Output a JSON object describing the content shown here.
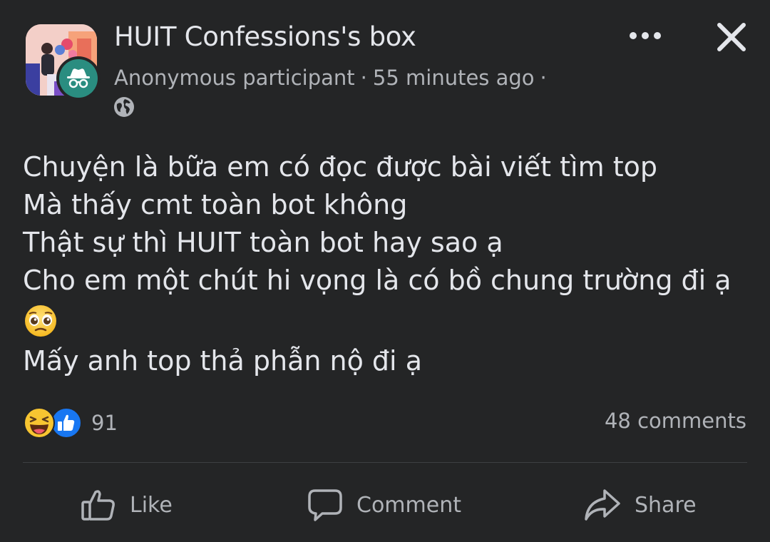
{
  "header": {
    "page_name": "HUIT Confessions's box",
    "author": "Anonymous participant",
    "separator": "·",
    "time": "55 minutes ago",
    "privacy_icon": "globe-icon",
    "more_icon": "more-horizontal-icon",
    "close_icon": "close-icon"
  },
  "post": {
    "lines": [
      "Chuyện là bữa em có đọc được bài viết tìm top",
      "Mà thấy cmt toàn bot không",
      "Thật sự thì HUIT toàn bot hay sao ạ",
      "Cho em một chút hi vọng là có bồ chung trường đi ạ"
    ],
    "emoji_icon": "pleading-face-emoji",
    "last_line": "Mấy anh top thả phẫn nộ đi ạ"
  },
  "reactions": {
    "icons": [
      "haha-reaction-icon",
      "like-reaction-icon"
    ],
    "count": "91",
    "comments": "48 comments"
  },
  "actions": {
    "like": "Like",
    "comment": "Comment",
    "share": "Share"
  },
  "colors": {
    "background": "#242526",
    "primary_text": "#e4e6eb",
    "secondary_text": "#b0b3b8",
    "like_blue": "#1877f2",
    "anon_teal": "#2a8d80"
  }
}
